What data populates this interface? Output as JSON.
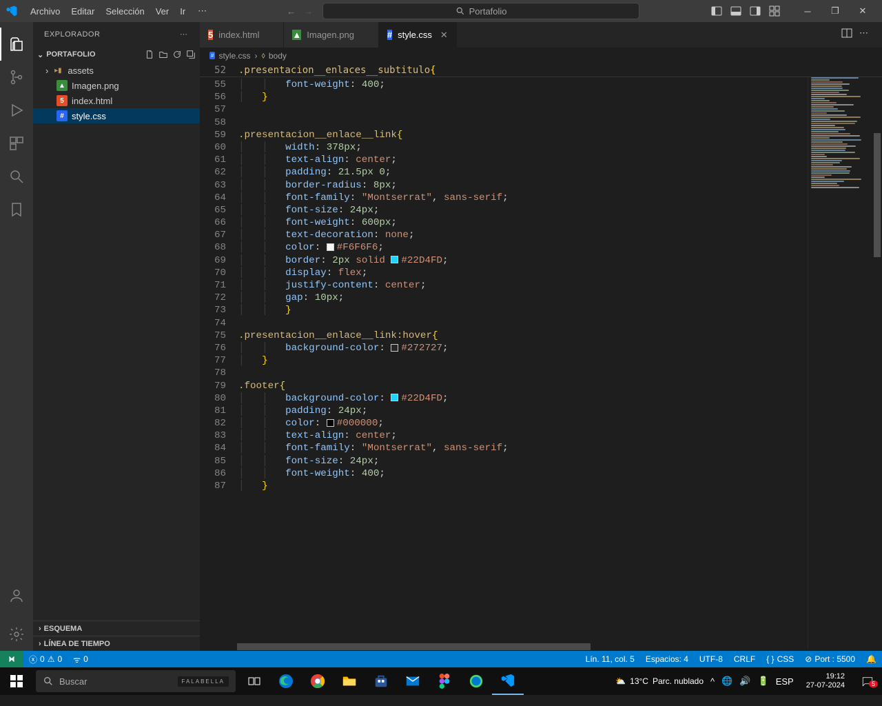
{
  "menu": {
    "items": [
      "Archivo",
      "Editar",
      "Selección",
      "Ver",
      "Ir"
    ]
  },
  "search_placeholder": "Portafolio",
  "explorer": {
    "title": "EXPLORADOR",
    "project": "PORTAFOLIO",
    "files": [
      {
        "name": "assets",
        "icon": "folder"
      },
      {
        "name": "Imagen.png",
        "icon": "image"
      },
      {
        "name": "index.html",
        "icon": "html"
      },
      {
        "name": "style.css",
        "icon": "css",
        "selected": true
      }
    ],
    "outline": "ESQUEMA",
    "timeline": "LÍNEA DE TIEMPO"
  },
  "tabs": [
    {
      "label": "index.html",
      "icon": "html"
    },
    {
      "label": "Imagen.png",
      "icon": "image"
    },
    {
      "label": "style.css",
      "icon": "css",
      "active": true
    }
  ],
  "breadcrumb": {
    "file": "style.css",
    "symbol": "body"
  },
  "sticky": {
    "line": "52",
    "text_sel": ".presentacion__enlaces__subtitulo",
    "text_brace": "{"
  },
  "code_lines": [
    {
      "n": "55",
      "segs": [
        [
          "indent",
          "        "
        ],
        [
          "prop",
          "font-weight"
        ],
        [
          "colon",
          ": "
        ],
        [
          "num",
          "400"
        ],
        [
          "punc",
          ";"
        ]
      ]
    },
    {
      "n": "56",
      "segs": [
        [
          "indent",
          "    "
        ],
        [
          "brace",
          "}"
        ]
      ]
    },
    {
      "n": "57",
      "segs": []
    },
    {
      "n": "58",
      "segs": []
    },
    {
      "n": "59",
      "segs": [
        [
          "sel",
          ".presentacion__enlace__link"
        ],
        [
          "brace",
          "{"
        ]
      ]
    },
    {
      "n": "60",
      "segs": [
        [
          "indent",
          "        "
        ],
        [
          "prop",
          "width"
        ],
        [
          "colon",
          ": "
        ],
        [
          "num",
          "378px"
        ],
        [
          "punc",
          ";"
        ]
      ]
    },
    {
      "n": "61",
      "segs": [
        [
          "indent",
          "        "
        ],
        [
          "prop",
          "text-align"
        ],
        [
          "colon",
          ": "
        ],
        [
          "const",
          "center"
        ],
        [
          "punc",
          ";"
        ]
      ]
    },
    {
      "n": "62",
      "segs": [
        [
          "indent",
          "        "
        ],
        [
          "prop",
          "padding"
        ],
        [
          "colon",
          ": "
        ],
        [
          "num",
          "21.5px 0"
        ],
        [
          "punc",
          ";"
        ]
      ]
    },
    {
      "n": "63",
      "segs": [
        [
          "indent",
          "        "
        ],
        [
          "prop",
          "border-radius"
        ],
        [
          "colon",
          ": "
        ],
        [
          "num",
          "8px"
        ],
        [
          "punc",
          ";"
        ]
      ]
    },
    {
      "n": "64",
      "segs": [
        [
          "indent",
          "        "
        ],
        [
          "prop",
          "font-family"
        ],
        [
          "colon",
          ": "
        ],
        [
          "str",
          "\"Montserrat\""
        ],
        [
          "punc",
          ", "
        ],
        [
          "const",
          "sans-serif"
        ],
        [
          "punc",
          ";"
        ]
      ]
    },
    {
      "n": "65",
      "segs": [
        [
          "indent",
          "        "
        ],
        [
          "prop",
          "font-size"
        ],
        [
          "colon",
          ": "
        ],
        [
          "num",
          "24px"
        ],
        [
          "punc",
          ";"
        ]
      ]
    },
    {
      "n": "66",
      "segs": [
        [
          "indent",
          "        "
        ],
        [
          "prop",
          "font-weight"
        ],
        [
          "colon",
          ": "
        ],
        [
          "num",
          "600px"
        ],
        [
          "punc",
          ";"
        ]
      ]
    },
    {
      "n": "67",
      "segs": [
        [
          "indent",
          "        "
        ],
        [
          "prop",
          "text-decoration"
        ],
        [
          "colon",
          ": "
        ],
        [
          "const",
          "none"
        ],
        [
          "punc",
          ";"
        ]
      ]
    },
    {
      "n": "68",
      "segs": [
        [
          "indent",
          "        "
        ],
        [
          "prop",
          "color"
        ],
        [
          "colon",
          ": "
        ],
        [
          "swatch",
          "#F6F6F6"
        ],
        [
          "const",
          "#F6F6F6"
        ],
        [
          "punc",
          ";"
        ]
      ]
    },
    {
      "n": "69",
      "segs": [
        [
          "indent",
          "        "
        ],
        [
          "prop",
          "border"
        ],
        [
          "colon",
          ": "
        ],
        [
          "num",
          "2px"
        ],
        [
          "punc",
          " "
        ],
        [
          "const",
          "solid"
        ],
        [
          "punc",
          " "
        ],
        [
          "swatch",
          "#22D4FD"
        ],
        [
          "const",
          "#22D4FD"
        ],
        [
          "punc",
          ";"
        ]
      ]
    },
    {
      "n": "70",
      "segs": [
        [
          "indent",
          "        "
        ],
        [
          "prop",
          "display"
        ],
        [
          "colon",
          ": "
        ],
        [
          "const",
          "flex"
        ],
        [
          "punc",
          ";"
        ]
      ]
    },
    {
      "n": "71",
      "segs": [
        [
          "indent",
          "        "
        ],
        [
          "prop",
          "justify-content"
        ],
        [
          "colon",
          ": "
        ],
        [
          "const",
          "center"
        ],
        [
          "punc",
          ";"
        ]
      ]
    },
    {
      "n": "72",
      "segs": [
        [
          "indent",
          "        "
        ],
        [
          "prop",
          "gap"
        ],
        [
          "colon",
          ": "
        ],
        [
          "num",
          "10px"
        ],
        [
          "punc",
          ";"
        ]
      ]
    },
    {
      "n": "73",
      "segs": [
        [
          "indent",
          "        "
        ],
        [
          "brace",
          "}"
        ]
      ]
    },
    {
      "n": "74",
      "segs": []
    },
    {
      "n": "75",
      "segs": [
        [
          "sel",
          ".presentacion__enlace__link:hover"
        ],
        [
          "brace",
          "{"
        ]
      ]
    },
    {
      "n": "76",
      "segs": [
        [
          "indent",
          "        "
        ],
        [
          "prop",
          "background-color"
        ],
        [
          "colon",
          ": "
        ],
        [
          "swatch",
          "#272727"
        ],
        [
          "const",
          "#272727"
        ],
        [
          "punc",
          ";"
        ]
      ]
    },
    {
      "n": "77",
      "segs": [
        [
          "indent",
          "    "
        ],
        [
          "brace",
          "}"
        ]
      ]
    },
    {
      "n": "78",
      "segs": []
    },
    {
      "n": "79",
      "segs": [
        [
          "sel",
          ".footer"
        ],
        [
          "brace",
          "{"
        ]
      ]
    },
    {
      "n": "80",
      "segs": [
        [
          "indent",
          "        "
        ],
        [
          "prop",
          "background-color"
        ],
        [
          "colon",
          ": "
        ],
        [
          "swatch",
          "#22D4FD"
        ],
        [
          "const",
          "#22D4FD"
        ],
        [
          "punc",
          ";"
        ]
      ]
    },
    {
      "n": "81",
      "segs": [
        [
          "indent",
          "        "
        ],
        [
          "prop",
          "padding"
        ],
        [
          "colon",
          ": "
        ],
        [
          "num",
          "24px"
        ],
        [
          "punc",
          ";"
        ]
      ]
    },
    {
      "n": "82",
      "segs": [
        [
          "indent",
          "        "
        ],
        [
          "prop",
          "color"
        ],
        [
          "colon",
          ": "
        ],
        [
          "swatch",
          "#000000"
        ],
        [
          "const",
          "#000000"
        ],
        [
          "punc",
          ";"
        ]
      ]
    },
    {
      "n": "83",
      "segs": [
        [
          "indent",
          "        "
        ],
        [
          "prop",
          "text-align"
        ],
        [
          "colon",
          ": "
        ],
        [
          "const",
          "center"
        ],
        [
          "punc",
          ";"
        ]
      ]
    },
    {
      "n": "84",
      "segs": [
        [
          "indent",
          "        "
        ],
        [
          "prop",
          "font-family"
        ],
        [
          "colon",
          ": "
        ],
        [
          "str",
          "\"Montserrat\""
        ],
        [
          "punc",
          ", "
        ],
        [
          "const",
          "sans-serif"
        ],
        [
          "punc",
          ";"
        ]
      ]
    },
    {
      "n": "85",
      "segs": [
        [
          "indent",
          "        "
        ],
        [
          "prop",
          "font-size"
        ],
        [
          "colon",
          ": "
        ],
        [
          "num",
          "24px"
        ],
        [
          "punc",
          ";"
        ]
      ]
    },
    {
      "n": "86",
      "segs": [
        [
          "indent",
          "        "
        ],
        [
          "prop",
          "font-weight"
        ],
        [
          "colon",
          ": "
        ],
        [
          "num",
          "400"
        ],
        [
          "punc",
          ";"
        ]
      ]
    },
    {
      "n": "87",
      "segs": [
        [
          "indent",
          "    "
        ],
        [
          "brace",
          "}"
        ]
      ]
    }
  ],
  "statusbar": {
    "errors": "0",
    "warnings": "0",
    "radio": "0",
    "line_col": "Lín. 11, col. 5",
    "spaces": "Espacios: 4",
    "encoding": "UTF-8",
    "eol": "CRLF",
    "lang": "CSS",
    "port": "Port : 5500"
  },
  "taskbar": {
    "search": "Buscar",
    "brand": "FALABELLA",
    "weather_temp": "13°C",
    "weather_desc": "Parc. nublado",
    "kb": "ESP",
    "time": "19:12",
    "date": "27-07-2024",
    "notif": "5"
  }
}
